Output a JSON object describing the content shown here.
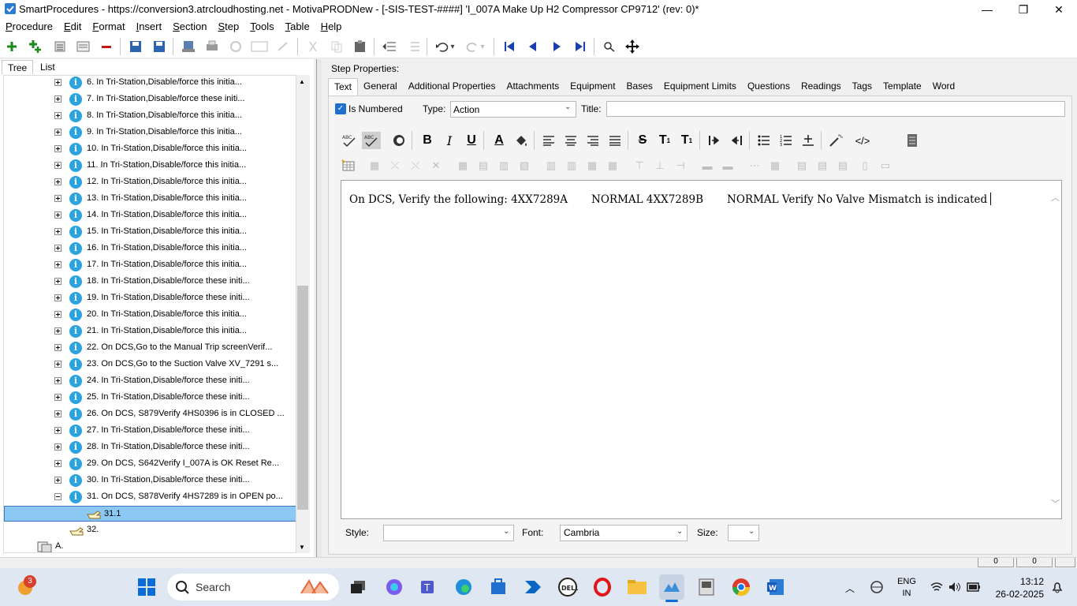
{
  "window": {
    "title": "SmartProcedures - https://conversion3.atrcloudhosting.net - MotivaPRODNew - [-SIS-TEST-####] 'I_007A Make Up H2 Compressor CP9712' (rev: 0)*",
    "minimize": "—",
    "maximize": "❐",
    "close": "✕"
  },
  "menu": [
    {
      "u": "P",
      "rest": "rocedure"
    },
    {
      "u": "E",
      "rest": "dit"
    },
    {
      "u": "F",
      "rest": "ormat"
    },
    {
      "u": "I",
      "rest": "nsert"
    },
    {
      "u": "S",
      "rest": "ection"
    },
    {
      "u": "S",
      "rest": "tep"
    },
    {
      "u": "T",
      "rest": "ools"
    },
    {
      "u": "T",
      "rest": "able"
    },
    {
      "u": "H",
      "rest": "elp"
    }
  ],
  "left_tabs": {
    "tree": "Tree",
    "list": "List"
  },
  "tree": {
    "items": [
      "6. In Tri-Station,Disable/force this initia...",
      "7. In Tri-Station,Disable/force these initi...",
      "8. In Tri-Station,Disable/force this initia...",
      "9. In Tri-Station,Disable/force this initia...",
      "10. In Tri-Station,Disable/force this initia...",
      "11. In Tri-Station,Disable/force this initia...",
      "12. In Tri-Station,Disable/force this initia...",
      "13. In Tri-Station,Disable/force this initia...",
      "14. In Tri-Station,Disable/force this initia...",
      "15. In Tri-Station,Disable/force this initia...",
      "16. In Tri-Station,Disable/force this initia...",
      "17. In Tri-Station,Disable/force this initia...",
      "18. In Tri-Station,Disable/force these initi...",
      "19. In Tri-Station,Disable/force these initi...",
      "20. In Tri-Station,Disable/force this initia...",
      "21. In Tri-Station,Disable/force this initia...",
      "22. On DCS,Go to the Manual Trip screenVerif...",
      "23. On DCS,Go to the Suction Valve XV_7291 s...",
      "24. In Tri-Station,Disable/force these initi...",
      "25. In Tri-Station,Disable/force these initi...",
      "26. On DCS, S879Verify 4HS0396 is in CLOSED ...",
      "27. In Tri-Station,Disable/force these initi...",
      "28. In Tri-Station,Disable/force these initi...",
      "29. On DCS, S642Verify I_007A is OK Reset Re...",
      "30. In Tri-Station,Disable/force these initi...",
      "31. On DCS, S878Verify 4HS7289 is in OPEN po..."
    ],
    "selected_sub": "31.1",
    "next_step": "32.",
    "section": "A."
  },
  "step_props": {
    "label": "Step Properties:",
    "tabs": [
      "Text",
      "General",
      "Additional Properties",
      "Attachments",
      "Equipment",
      "Bases",
      "Equipment Limits",
      "Questions",
      "Readings",
      "Tags",
      "Template",
      "Word"
    ],
    "is_numbered_label": "Is Numbered",
    "is_numbered": true,
    "type_label": "Type:",
    "type_value": "Action",
    "title_label": "Title:",
    "title_value": ""
  },
  "editor": {
    "text": "On DCS, Verify the following: 4XX7289A       NORMAL 4XX7289B       NORMAL Verify No Valve Mismatch is indicated"
  },
  "format_bar": {
    "style_label": "Style:",
    "style_value": "",
    "font_label": "Font:",
    "font_value": "Cambria",
    "size_label": "Size:",
    "size_value": ""
  },
  "status": {
    "panel1": "0",
    "panel2": "0"
  },
  "taskbar": {
    "search_placeholder": "Search",
    "notification_count": "3",
    "language": "ENG",
    "region": "IN",
    "time": "13:12",
    "date": "26-02-2025"
  }
}
